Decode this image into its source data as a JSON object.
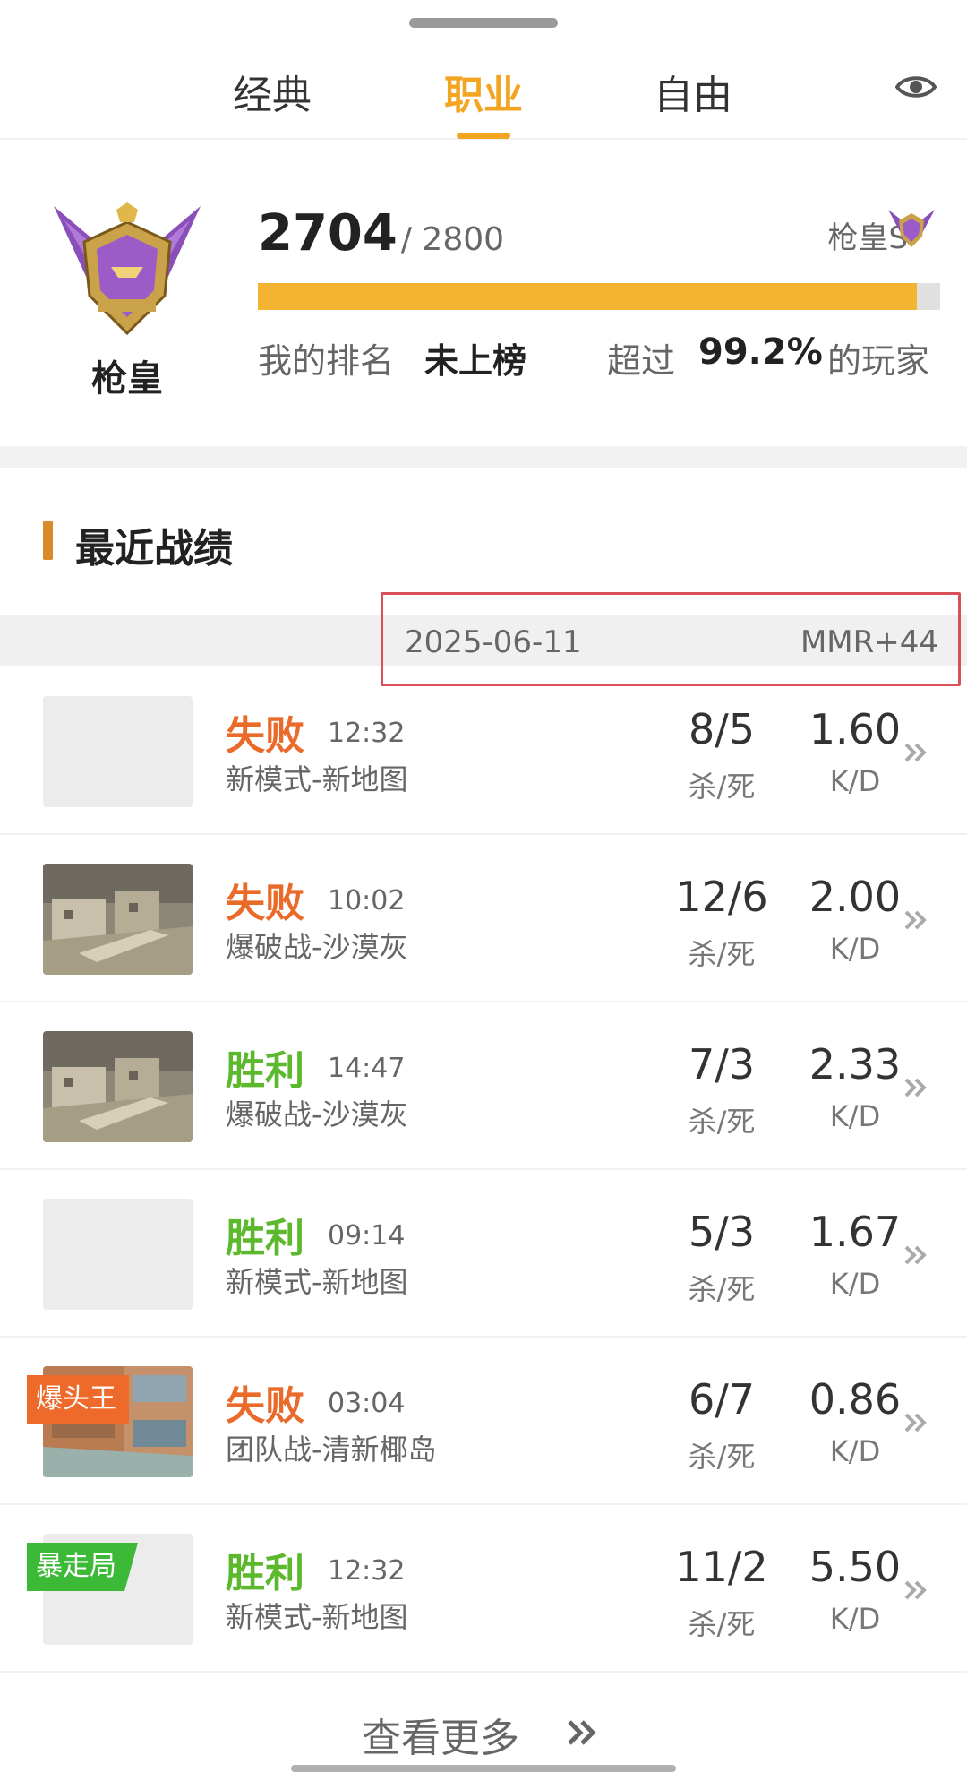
{
  "tabs": [
    {
      "label": "经典"
    },
    {
      "label": "职业"
    },
    {
      "label": "自由"
    }
  ],
  "rank": {
    "badge_name": "枪皇",
    "score": "2704",
    "score_max": "/ 2800",
    "tier": "枪皇S",
    "progress": 0.966,
    "my_rank_label": "我的排名",
    "my_rank_value": "未上榜",
    "percent_prefix": "超过",
    "percent_value": "99.2%",
    "percent_suffix": "的玩家"
  },
  "section": {
    "title": "最近战绩"
  },
  "date_row": {
    "date": "2025-06-11",
    "mmr": "MMR+44"
  },
  "matches": [
    {
      "result": "失败",
      "outcome": "lose",
      "time": "12:32",
      "mode": "新模式-新地图",
      "kd_ratio": "8/5",
      "kd_label": "杀/死",
      "kd": "1.60",
      "kd_unit": "K/D",
      "tag": "",
      "thumb": "blank"
    },
    {
      "result": "失败",
      "outcome": "lose",
      "time": "10:02",
      "mode": "爆破战-沙漠灰",
      "kd_ratio": "12/6",
      "kd_label": "杀/死",
      "kd": "2.00",
      "kd_unit": "K/D",
      "tag": "",
      "thumb": "desert"
    },
    {
      "result": "胜利",
      "outcome": "win",
      "time": "14:47",
      "mode": "爆破战-沙漠灰",
      "kd_ratio": "7/3",
      "kd_label": "杀/死",
      "kd": "2.33",
      "kd_unit": "K/D",
      "tag": "",
      "thumb": "desert"
    },
    {
      "result": "胜利",
      "outcome": "win",
      "time": "09:14",
      "mode": "新模式-新地图",
      "kd_ratio": "5/3",
      "kd_label": "杀/死",
      "kd": "1.67",
      "kd_unit": "K/D",
      "tag": "",
      "thumb": "blank"
    },
    {
      "result": "失败",
      "outcome": "lose",
      "time": "03:04",
      "mode": "团队战-清新椰岛",
      "kd_ratio": "6/7",
      "kd_label": "杀/死",
      "kd": "0.86",
      "kd_unit": "K/D",
      "tag": "爆头王",
      "tag_color": "orange",
      "thumb": "island"
    },
    {
      "result": "胜利",
      "outcome": "win",
      "time": "12:32",
      "mode": "新模式-新地图",
      "kd_ratio": "11/2",
      "kd_label": "杀/死",
      "kd": "5.50",
      "kd_unit": "K/D",
      "tag": "暴走局",
      "tag_color": "green",
      "thumb": "blank"
    }
  ],
  "footer": {
    "more_label": "查看更多"
  },
  "colors": {
    "accent": "#f3a522",
    "lose": "#ea6a2a",
    "win": "#5cb82c",
    "highlight": "#d9505a"
  }
}
